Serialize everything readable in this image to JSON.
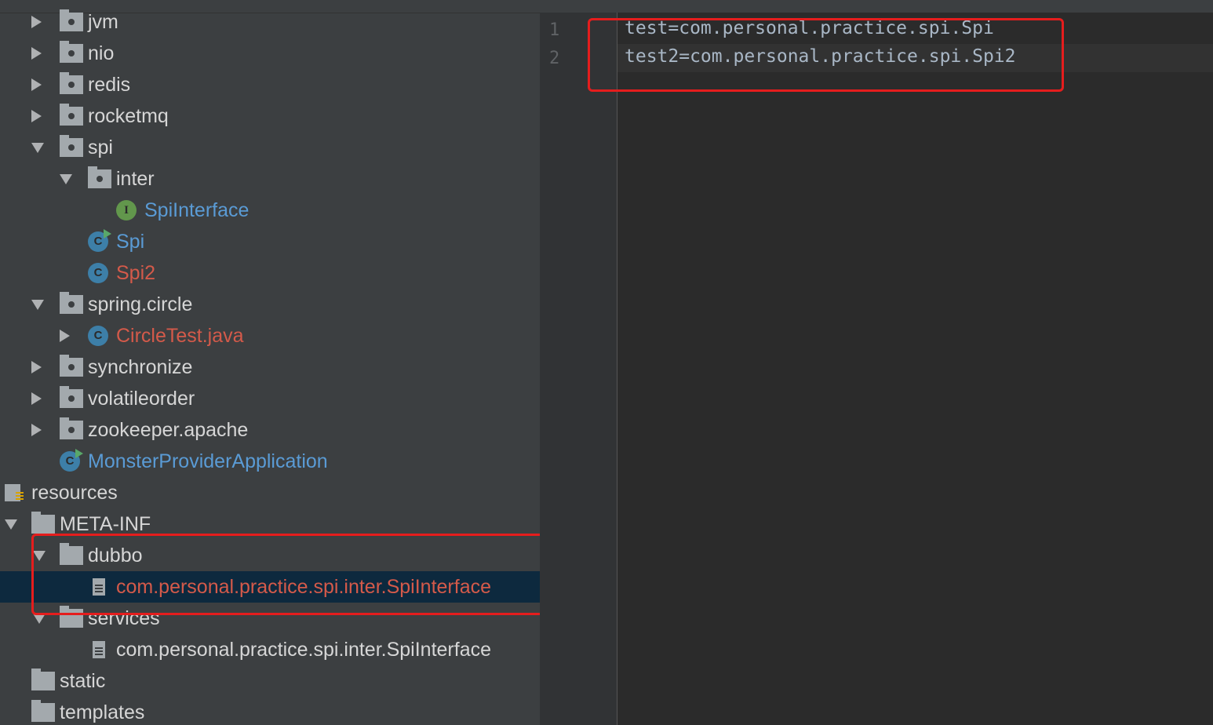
{
  "project_tree": {
    "items": [
      {
        "label": "jvm",
        "color": "#d6d6d6"
      },
      {
        "label": "nio",
        "color": "#d6d6d6"
      },
      {
        "label": "redis",
        "color": "#d6d6d6"
      },
      {
        "label": "rocketmq",
        "color": "#d6d6d6"
      },
      {
        "label": "spi",
        "color": "#d6d6d6"
      },
      {
        "label": "inter",
        "color": "#d6d6d6"
      },
      {
        "label": "SpiInterface",
        "color": "#5a9bd5"
      },
      {
        "label": "Spi",
        "color": "#5a9bd5"
      },
      {
        "label": "Spi2",
        "color": "#d45a4a"
      },
      {
        "label": "spring.circle",
        "color": "#d6d6d6"
      },
      {
        "label": "CircleTest.java",
        "color": "#d45a4a"
      },
      {
        "label": "synchronize",
        "color": "#d6d6d6"
      },
      {
        "label": "volatileorder",
        "color": "#d6d6d6"
      },
      {
        "label": "zookeeper.apache",
        "color": "#d6d6d6"
      },
      {
        "label": "MonsterProviderApplication",
        "color": "#5a9bd5"
      },
      {
        "label": "resources",
        "color": "#d6d6d6"
      },
      {
        "label": "META-INF",
        "color": "#d6d6d6"
      },
      {
        "label": "dubbo",
        "color": "#d6d6d6"
      },
      {
        "label": "com.personal.practice.spi.inter.SpiInterface",
        "color": "#d45a4a"
      },
      {
        "label": "services",
        "color": "#d6d6d6"
      },
      {
        "label": "com.personal.practice.spi.inter.SpiInterface",
        "color": "#d6d6d6"
      },
      {
        "label": "static",
        "color": "#d6d6d6"
      },
      {
        "label": "templates",
        "color": "#d6d6d6"
      }
    ],
    "icon_glyphs": {
      "class": "C",
      "interface": "I"
    }
  },
  "editor": {
    "lines": [
      {
        "number": "1",
        "text": "test=com.personal.practice.spi.Spi"
      },
      {
        "number": "2",
        "text": "test2=com.personal.practice.spi.Spi2"
      }
    ]
  },
  "colors": {
    "highlight_box": "#e51d1d",
    "selected_row": "#0d293e"
  }
}
